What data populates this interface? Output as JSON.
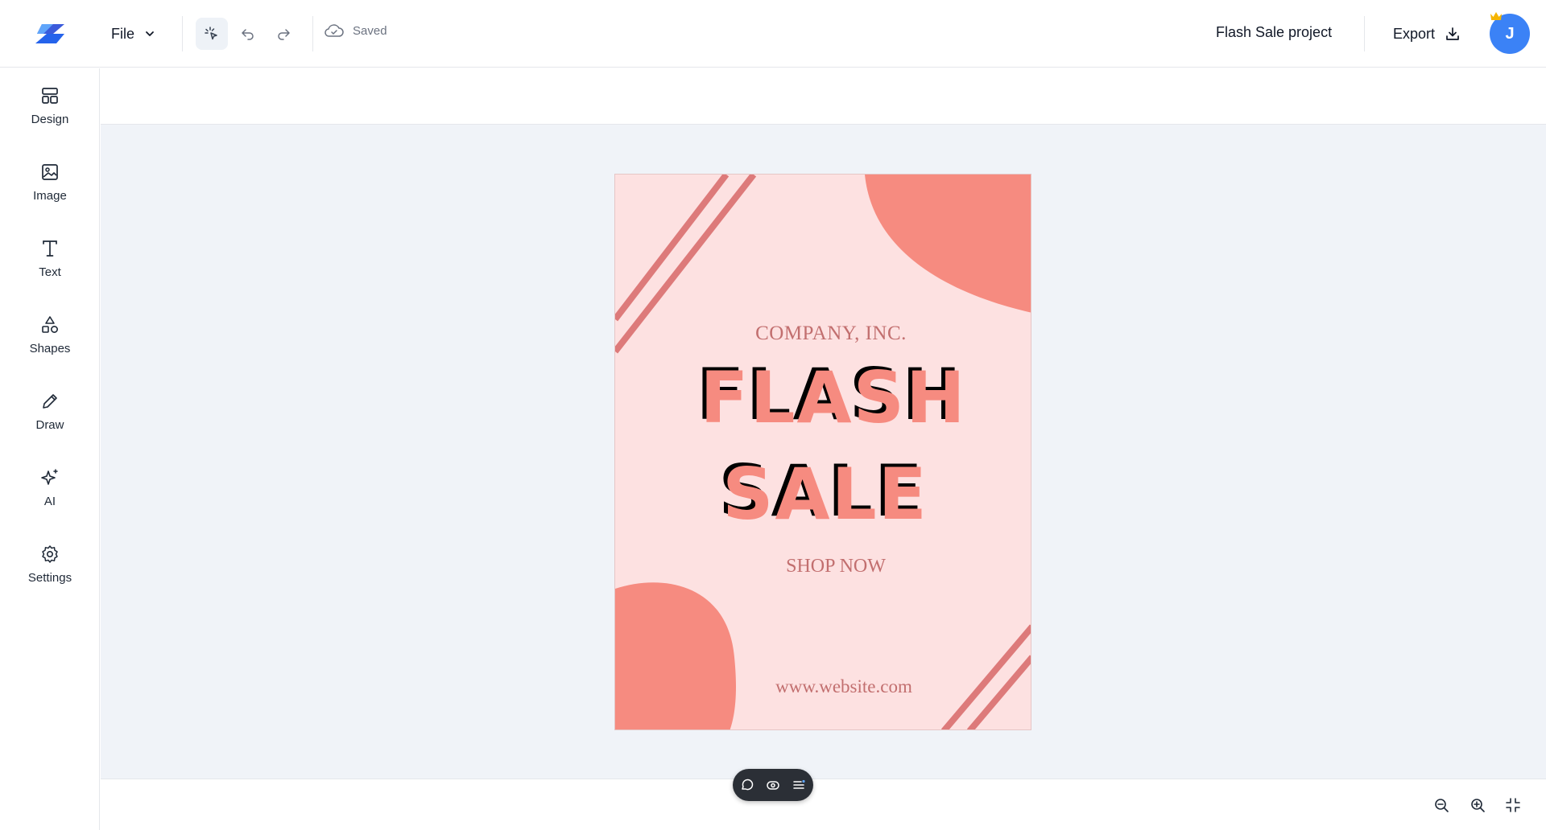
{
  "header": {
    "file_label": "File",
    "save_status": "Saved",
    "project_title": "Flash Sale project",
    "export_label": "Export",
    "avatar_initial": "J"
  },
  "sidebar": {
    "items": [
      {
        "label": "Design",
        "icon": "layout-icon"
      },
      {
        "label": "Image",
        "icon": "image-icon"
      },
      {
        "label": "Text",
        "icon": "text-icon"
      },
      {
        "label": "Shapes",
        "icon": "shapes-icon"
      },
      {
        "label": "Draw",
        "icon": "pencil-icon"
      },
      {
        "label": "AI",
        "icon": "sparkles-icon"
      },
      {
        "label": "Settings",
        "icon": "gear-icon"
      }
    ]
  },
  "poster": {
    "company": "COMPANY, INC.",
    "headline_1": "FLASH",
    "headline_2": "SALE",
    "cta": "SHOP NOW",
    "website": "www.website.com",
    "colors": {
      "background": "#fde1e1",
      "accent": "#f68b80",
      "stripes": "#dd7a7a",
      "text": "#c26f6f"
    }
  },
  "floating_toolbar": {
    "icons": [
      "comment-icon",
      "eye-icon",
      "list-icon"
    ]
  },
  "zoom_controls": {
    "icons": [
      "zoom-out-icon",
      "zoom-in-icon",
      "collapse-icon"
    ]
  },
  "colors": {
    "brand_blue": "#3b82f6",
    "canvas_bg": "#f0f3f8"
  }
}
